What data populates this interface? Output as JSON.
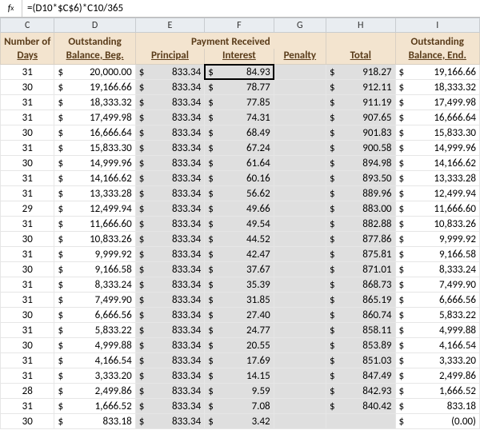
{
  "formula_bar": {
    "fx_label": "fx",
    "value": "=(D10*$C$6)*C10/365"
  },
  "column_letters": [
    "C",
    "D",
    "E",
    "F",
    "G",
    "H",
    "I"
  ],
  "headers": {
    "number_of": "Number of",
    "days": "Days",
    "out_beg_top": "Outstanding",
    "out_beg_bot": "Balance, Beg.",
    "payment_received": "Payment Received",
    "principal": "Principal",
    "interest": "Interest",
    "penalty": "Penalty",
    "total": "Total",
    "out_end_top": "Outstanding",
    "out_end_bot": "Balance, End."
  },
  "rows": [
    {
      "days": "31",
      "beg": "20,000.00",
      "prin": "833.34",
      "int": "84.93",
      "pen": "",
      "tot": "918.27",
      "end": "19,166.66"
    },
    {
      "days": "30",
      "beg": "19,166.66",
      "prin": "833.34",
      "int": "78.77",
      "pen": "",
      "tot": "912.11",
      "end": "18,333.32"
    },
    {
      "days": "31",
      "beg": "18,333.32",
      "prin": "833.34",
      "int": "77.85",
      "pen": "",
      "tot": "911.19",
      "end": "17,499.98"
    },
    {
      "days": "31",
      "beg": "17,499.98",
      "prin": "833.34",
      "int": "74.31",
      "pen": "",
      "tot": "907.65",
      "end": "16,666.64"
    },
    {
      "days": "30",
      "beg": "16,666.64",
      "prin": "833.34",
      "int": "68.49",
      "pen": "",
      "tot": "901.83",
      "end": "15,833.30"
    },
    {
      "days": "31",
      "beg": "15,833.30",
      "prin": "833.34",
      "int": "67.24",
      "pen": "",
      "tot": "900.58",
      "end": "14,999.96"
    },
    {
      "days": "30",
      "beg": "14,999.96",
      "prin": "833.34",
      "int": "61.64",
      "pen": "",
      "tot": "894.98",
      "end": "14,166.62"
    },
    {
      "days": "31",
      "beg": "14,166.62",
      "prin": "833.34",
      "int": "60.16",
      "pen": "",
      "tot": "893.50",
      "end": "13,333.28"
    },
    {
      "days": "31",
      "beg": "13,333.28",
      "prin": "833.34",
      "int": "56.62",
      "pen": "",
      "tot": "889.96",
      "end": "12,499.94"
    },
    {
      "days": "29",
      "beg": "12,499.94",
      "prin": "833.34",
      "int": "49.66",
      "pen": "",
      "tot": "883.00",
      "end": "11,666.60"
    },
    {
      "days": "31",
      "beg": "11,666.60",
      "prin": "833.34",
      "int": "49.54",
      "pen": "",
      "tot": "882.88",
      "end": "10,833.26"
    },
    {
      "days": "30",
      "beg": "10,833.26",
      "prin": "833.34",
      "int": "44.52",
      "pen": "",
      "tot": "877.86",
      "end": "9,999.92"
    },
    {
      "days": "31",
      "beg": "9,999.92",
      "prin": "833.34",
      "int": "42.47",
      "pen": "",
      "tot": "875.81",
      "end": "9,166.58"
    },
    {
      "days": "30",
      "beg": "9,166.58",
      "prin": "833.34",
      "int": "37.67",
      "pen": "",
      "tot": "871.01",
      "end": "8,333.24"
    },
    {
      "days": "31",
      "beg": "8,333.24",
      "prin": "833.34",
      "int": "35.39",
      "pen": "",
      "tot": "868.73",
      "end": "7,499.90"
    },
    {
      "days": "31",
      "beg": "7,499.90",
      "prin": "833.34",
      "int": "31.85",
      "pen": "",
      "tot": "865.19",
      "end": "6,666.56"
    },
    {
      "days": "30",
      "beg": "6,666.56",
      "prin": "833.34",
      "int": "27.40",
      "pen": "",
      "tot": "860.74",
      "end": "5,833.22"
    },
    {
      "days": "31",
      "beg": "5,833.22",
      "prin": "833.34",
      "int": "24.77",
      "pen": "",
      "tot": "858.11",
      "end": "4,999.88"
    },
    {
      "days": "30",
      "beg": "4,999.88",
      "prin": "833.34",
      "int": "20.55",
      "pen": "",
      "tot": "853.89",
      "end": "4,166.54"
    },
    {
      "days": "31",
      "beg": "4,166.54",
      "prin": "833.34",
      "int": "17.69",
      "pen": "",
      "tot": "851.03",
      "end": "3,333.20"
    },
    {
      "days": "31",
      "beg": "3,333.20",
      "prin": "833.34",
      "int": "14.15",
      "pen": "",
      "tot": "847.49",
      "end": "2,499.86"
    },
    {
      "days": "28",
      "beg": "2,499.86",
      "prin": "833.34",
      "int": "9.59",
      "pen": "",
      "tot": "842.93",
      "end": "1,666.52"
    },
    {
      "days": "31",
      "beg": "1,666.52",
      "prin": "833.34",
      "int": "7.08",
      "pen": "",
      "tot": "840.42",
      "end": "833.18"
    }
  ],
  "partial_row": {
    "days": "30",
    "beg": "833.18",
    "prin": "833.34",
    "int": "3.42",
    "pen": "",
    "tot": "",
    "end": "(0.00)"
  },
  "currency_symbol": "$",
  "active_cell": {
    "row": 0,
    "field": "int"
  }
}
